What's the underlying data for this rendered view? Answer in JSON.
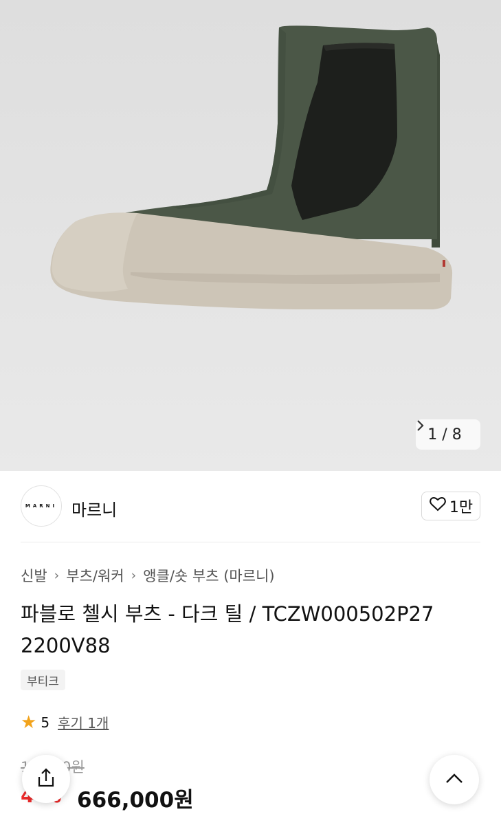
{
  "gallery": {
    "index": "1",
    "separator": "/",
    "total": "8",
    "image_alt": "Marni Pablo Chelsea boot in dark teal leather"
  },
  "brand": {
    "logo_text": "MARNI",
    "name": "마르니",
    "likes": "1만"
  },
  "breadcrumb": [
    "신발",
    "부츠/워커",
    "앵클/숏 부츠 (마르니)"
  ],
  "product": {
    "title": "파블로 첼시 부츠 - 다크 틸 / TCZW000502P27 2200V88",
    "tag": "부티크"
  },
  "rating": {
    "score": "5",
    "reviews": "후기 1개"
  },
  "price": {
    "original": "1,   ,000원",
    "discount": "4 %",
    "current": "666,000원"
  },
  "icons": {
    "chevron": "chevron-right-icon",
    "heart": "heart-icon",
    "star": "star-icon",
    "share": "share-icon",
    "up": "chevron-up-icon"
  },
  "colors": {
    "accent_red": "#ee2b2b",
    "star": "#f2a31b",
    "boot_upper": "#4b5747",
    "boot_sole": "#cdc5b7"
  }
}
